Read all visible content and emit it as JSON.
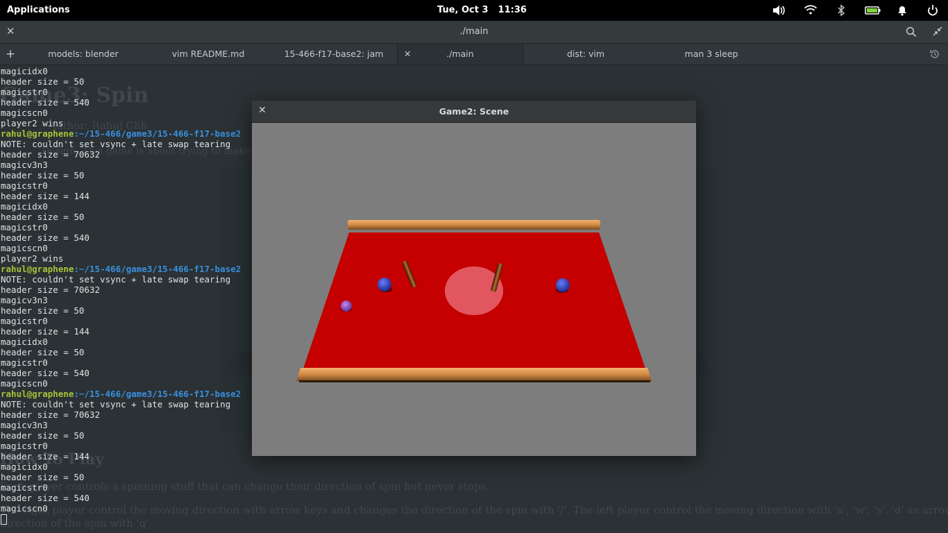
{
  "topbar": {
    "applications": "Applications",
    "date": "Tue, Oct  3",
    "time": "11:36",
    "tray_icons": [
      "volume-icon",
      "wifi-icon",
      "bluetooth-icon",
      "battery-icon",
      "notification-icon",
      "power-icon"
    ]
  },
  "terminal": {
    "title": "./main",
    "tabs": [
      {
        "label": "models: blender"
      },
      {
        "label": "vim README.md"
      },
      {
        "label": "15-466-f17-base2: jam"
      },
      {
        "label": "./main",
        "active": true
      },
      {
        "label": "dist: vim"
      },
      {
        "label": "man 3 sleep"
      }
    ],
    "background_doc": {
      "heading": "Game3: Spin",
      "sub1": "Author: Rahul Chh",
      "sub2": "Design: This game is about trying to make the",
      "section": "How To Play",
      "para1": "Each player controls a spinning stuff that can change their direction of spin but never stops.",
      "para2": "The right player control the moving direction with arrow keys and changes the direction of the spin with '/'. The left player control the moving direction with 'a', 'w', 's', 'd' as arrow keys and changes the",
      "para3": "direction of the spin with 'q'."
    },
    "lines": [
      {
        "t": "magicidx0"
      },
      {
        "t": "header size = 50"
      },
      {
        "t": "magicstr0"
      },
      {
        "t": "header size = 540"
      },
      {
        "t": "magicscn0"
      },
      {
        "t": "player2 wins"
      },
      {
        "user": "rahul@graphene",
        "path": ":~/15-466/game3/15-466-f17-base2"
      },
      {
        "t": "NOTE: couldn't set vsync + late swap tearing"
      },
      {
        "t": "header size = 70632"
      },
      {
        "t": "magicv3n3"
      },
      {
        "t": "header size = 50"
      },
      {
        "t": "magicstr0"
      },
      {
        "t": "header size = 144"
      },
      {
        "t": "magicidx0"
      },
      {
        "t": "header size = 50"
      },
      {
        "t": "magicstr0"
      },
      {
        "t": "header size = 540"
      },
      {
        "t": "magicscn0"
      },
      {
        "t": "player2 wins"
      },
      {
        "user": "rahul@graphene",
        "path": ":~/15-466/game3/15-466-f17-base2"
      },
      {
        "t": "NOTE: couldn't set vsync + late swap tearing"
      },
      {
        "t": "header size = 70632"
      },
      {
        "t": "magicv3n3"
      },
      {
        "t": "header size = 50"
      },
      {
        "t": "magicstr0"
      },
      {
        "t": "header size = 144"
      },
      {
        "t": "magicidx0"
      },
      {
        "t": "header size = 50"
      },
      {
        "t": "magicstr0"
      },
      {
        "t": "header size = 540"
      },
      {
        "t": "magicscn0"
      },
      {
        "user": "rahul@graphene",
        "path": ":~/15-466/game3/15-466-f17-base2"
      },
      {
        "t": "NOTE: couldn't set vsync + late swap tearing"
      },
      {
        "t": "header size = 70632"
      },
      {
        "t": "magicv3n3"
      },
      {
        "t": "header size = 50"
      },
      {
        "t": "magicstr0"
      },
      {
        "t": "header size = 144"
      },
      {
        "t": "magicidx0"
      },
      {
        "t": "header size = 50"
      },
      {
        "t": "magicstr0"
      },
      {
        "t": "header size = 540"
      },
      {
        "t": "magicscn0"
      },
      {
        "cursor": true
      }
    ]
  },
  "game_window": {
    "title": "Game2: Scene",
    "colors": {
      "table": "#c40000",
      "rail": "#d18a45",
      "zone": "#e2575f",
      "ball": "#3a4fd0",
      "ball_small": "#9a4fd0",
      "background": "#7d7d7d"
    }
  }
}
